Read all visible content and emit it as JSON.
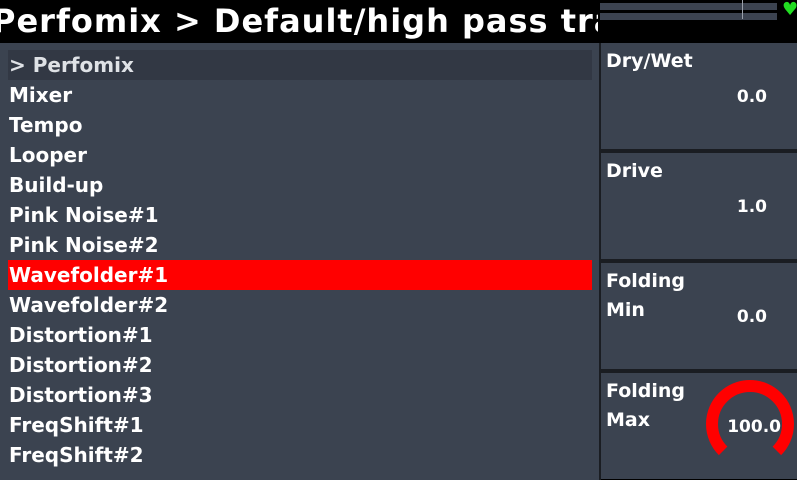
{
  "header": {
    "title": "Perfomix > Default/high pass tra"
  },
  "status": {
    "heart_icon": "heart-icon",
    "heart_color": "#22dd22"
  },
  "menu": {
    "items": [
      {
        "label": "> Perfomix"
      },
      {
        "label": "Mixer"
      },
      {
        "label": "Tempo"
      },
      {
        "label": "Looper"
      },
      {
        "label": "Build-up"
      },
      {
        "label": "Pink Noise#1"
      },
      {
        "label": "Pink Noise#2"
      },
      {
        "label": "Wavefolder#1"
      },
      {
        "label": "Wavefolder#2"
      },
      {
        "label": "Distortion#1"
      },
      {
        "label": "Distortion#2"
      },
      {
        "label": "Distortion#3"
      },
      {
        "label": "FreqShift#1"
      },
      {
        "label": "FreqShift#2"
      }
    ],
    "selected_color": "#ff0000"
  },
  "params": [
    {
      "label": "Dry/Wet",
      "value": "0.0"
    },
    {
      "label": "Drive",
      "value": "1.0"
    },
    {
      "label": "Folding\nMin",
      "value": "0.0"
    },
    {
      "label": "Folding\nMax",
      "value": "100.0",
      "knob_fraction": 1.0,
      "knob_color": "#ff0000"
    }
  ]
}
